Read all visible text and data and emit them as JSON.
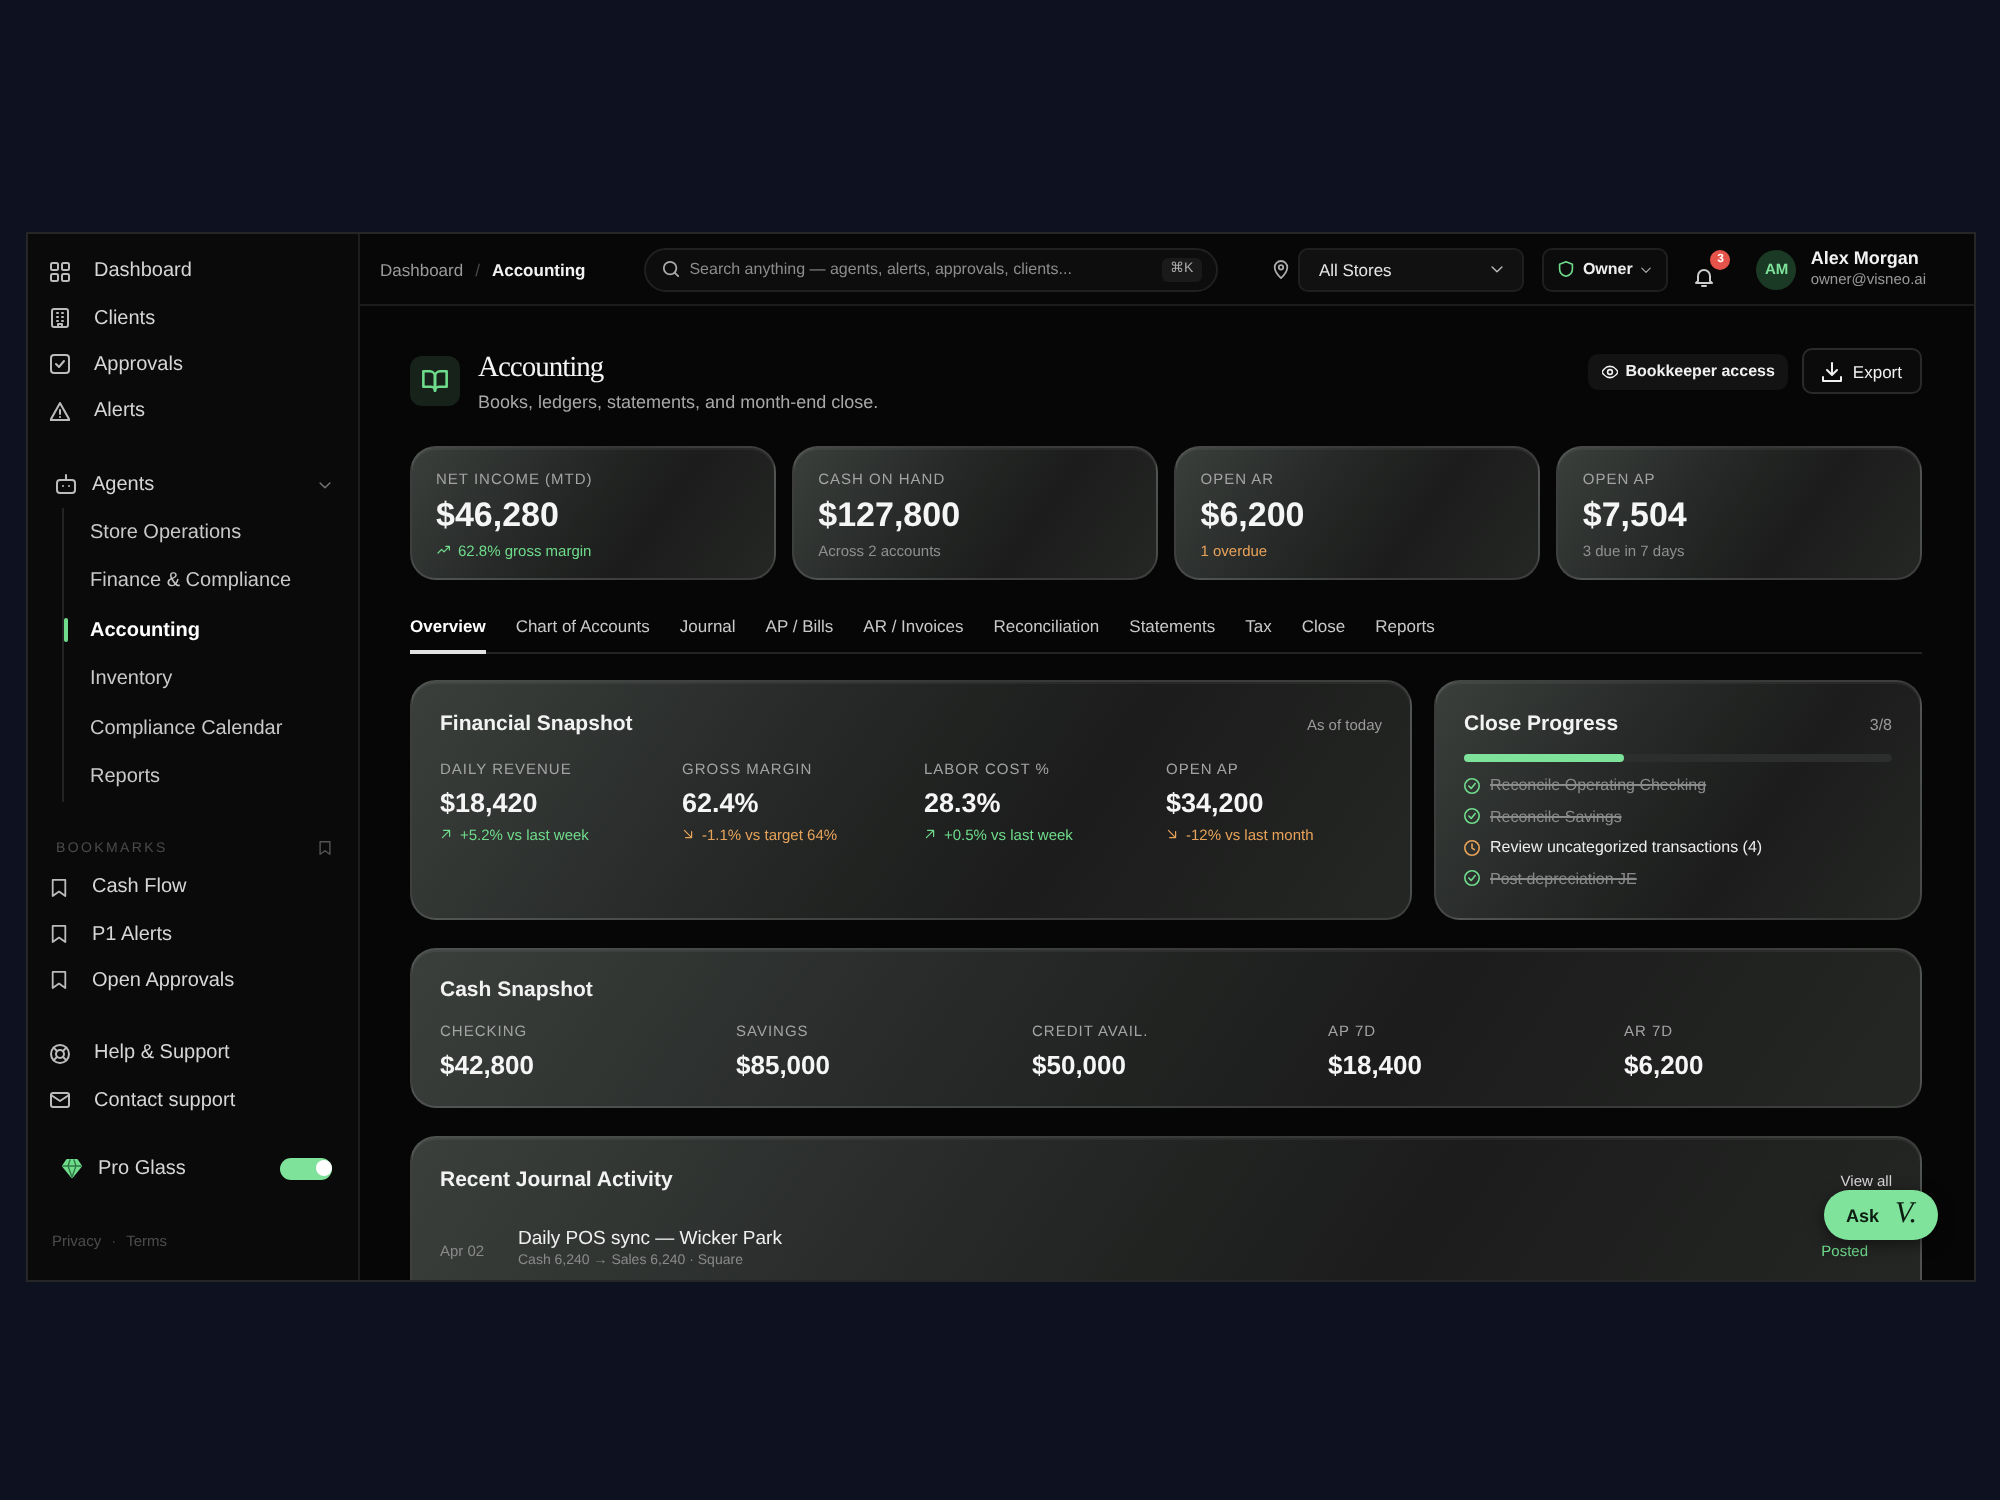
{
  "sidebar": {
    "nav": [
      {
        "label": "Dashboard"
      },
      {
        "label": "Clients"
      },
      {
        "label": "Approvals"
      },
      {
        "label": "Alerts"
      }
    ],
    "agents": {
      "label": "Agents",
      "expanded": true,
      "children": [
        {
          "label": "Store Operations",
          "selected": false
        },
        {
          "label": "Finance & Compliance",
          "selected": false
        },
        {
          "label": "Accounting",
          "selected": true
        },
        {
          "label": "Inventory",
          "selected": false
        },
        {
          "label": "Compliance Calendar",
          "selected": false
        },
        {
          "label": "Reports",
          "selected": false
        }
      ]
    },
    "bookmarks": {
      "heading": "BOOKMARKS",
      "items": [
        {
          "label": "Cash Flow"
        },
        {
          "label": "P1 Alerts"
        },
        {
          "label": "Open Approvals"
        }
      ]
    },
    "support": [
      {
        "label": "Help & Support"
      },
      {
        "label": "Contact support"
      }
    ],
    "pro_glass": {
      "label": "Pro Glass",
      "on": true
    },
    "footer": {
      "links": [
        "Privacy",
        "Terms"
      ],
      "separator": "·"
    }
  },
  "topbar": {
    "breadcrumb": {
      "items": [
        "Dashboard",
        "Accounting"
      ],
      "separator": "/"
    },
    "search": {
      "placeholder": "Search anything — agents, alerts, approvals, clients...",
      "shortcut": "⌘K"
    },
    "store_select": {
      "value": "All Stores"
    },
    "role_menu": {
      "label": "Owner"
    },
    "notifications": {
      "count": "3"
    },
    "user": {
      "initials": "AM",
      "name": "Alex Morgan",
      "email": "owner@visneo.ai"
    }
  },
  "header": {
    "title": "Accounting",
    "subtitle": "Books, ledgers, statements, and month-end close.",
    "actions": [
      {
        "label": "Bookkeeper access",
        "kind": "ghost"
      },
      {
        "label": "Export",
        "kind": "outline"
      }
    ]
  },
  "kpis": [
    {
      "label": "NET INCOME (MTD)",
      "value": "$46,280",
      "note": "62.8% gross margin",
      "kind": "positive"
    },
    {
      "label": "CASH ON HAND",
      "value": "$127,800",
      "note": "Across 2 accounts",
      "kind": "neutral"
    },
    {
      "label": "OPEN AR",
      "value": "$6,200",
      "note": "1 overdue",
      "kind": "warning"
    },
    {
      "label": "OPEN AP",
      "value": "$7,504",
      "note": "3 due in 7 days",
      "kind": "neutral"
    }
  ],
  "tabs": [
    {
      "label": "Overview",
      "selected": true
    },
    {
      "label": "Chart of Accounts",
      "selected": false
    },
    {
      "label": "Journal",
      "selected": false
    },
    {
      "label": "AP / Bills",
      "selected": false
    },
    {
      "label": "AR / Invoices",
      "selected": false
    },
    {
      "label": "Reconciliation",
      "selected": false
    },
    {
      "label": "Statements",
      "selected": false
    },
    {
      "label": "Tax",
      "selected": false
    },
    {
      "label": "Close",
      "selected": false
    },
    {
      "label": "Reports",
      "selected": false
    }
  ],
  "financial_snapshot": {
    "title": "Financial Snapshot",
    "as_of": "As of today",
    "metrics": [
      {
        "label": "DAILY REVENUE",
        "value": "$18,420",
        "delta": "+5.2% vs last week",
        "kind": "up"
      },
      {
        "label": "GROSS MARGIN",
        "value": "62.4%",
        "delta": "-1.1% vs target 64%",
        "kind": "down"
      },
      {
        "label": "LABOR COST %",
        "value": "28.3%",
        "delta": "+0.5% vs last week",
        "kind": "up"
      },
      {
        "label": "OPEN AP",
        "value": "$34,200",
        "delta": "-12% vs last month",
        "kind": "down"
      }
    ]
  },
  "close_progress": {
    "title": "Close Progress",
    "count": "3/8",
    "level": 0.375,
    "tasks": [
      {
        "label": "Reconcile Operating Checking",
        "done": true
      },
      {
        "label": "Reconcile Savings",
        "done": true
      },
      {
        "label": "Review uncategorized transactions (4)",
        "done": false
      },
      {
        "label": "Post depreciation JE",
        "done": true
      }
    ]
  },
  "cash_snapshot": {
    "title": "Cash Snapshot",
    "items": [
      {
        "label": "CHECKING",
        "value": "$42,800"
      },
      {
        "label": "SAVINGS",
        "value": "$85,000"
      },
      {
        "label": "CREDIT AVAIL.",
        "value": "$50,000"
      },
      {
        "label": "AP 7D",
        "value": "$18,400"
      },
      {
        "label": "AR 7D",
        "value": "$6,200"
      }
    ]
  },
  "journal": {
    "title": "Recent Journal Activity",
    "link": "View all",
    "entries": [
      {
        "date": "Apr 02",
        "title": "Daily POS sync — Wicker Park",
        "detail": "Cash 6,240 → Sales 6,240 · Square",
        "status": "Posted"
      }
    ]
  },
  "ask_button": {
    "label": "Ask",
    "logo": "V."
  }
}
